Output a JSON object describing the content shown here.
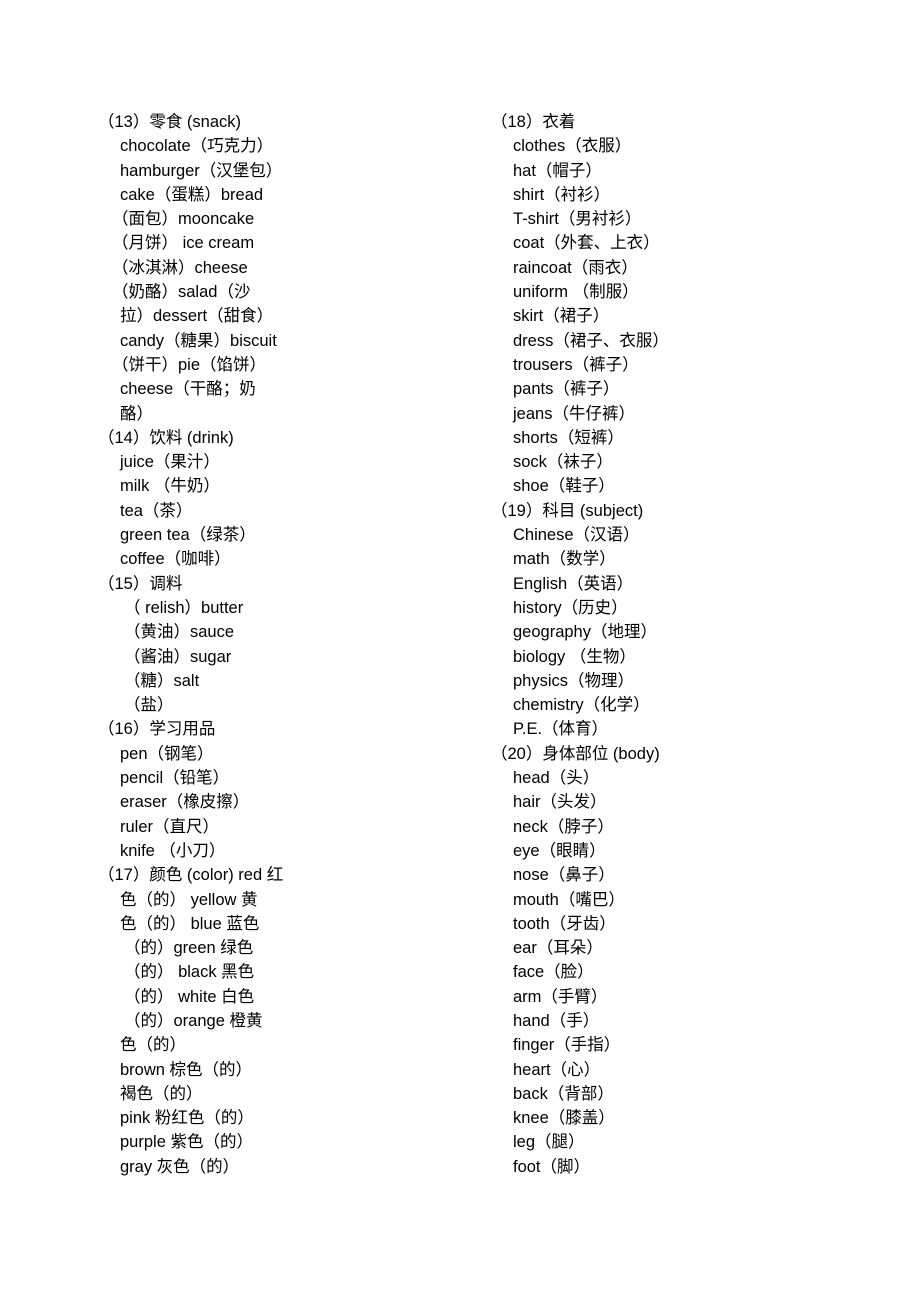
{
  "document": {
    "type": "vocabulary-word-list",
    "language_pair": "English-Chinese",
    "columns": [
      {
        "id": "left-column",
        "sections": [
          {
            "heading": "（13）零食 (snack)",
            "lines": [
              {
                "text": "chocolate（巧克力）",
                "indent": "i1"
              },
              {
                "text": "hamburger（汉堡包）",
                "indent": "i1"
              },
              {
                "text": "cake（蛋糕）bread",
                "indent": "i1"
              },
              {
                "text": "（面包）mooncake",
                "indent": "i2"
              },
              {
                "text": "（月饼） ice cream",
                "indent": "i2"
              },
              {
                "text": "（冰淇淋）cheese",
                "indent": "i2"
              },
              {
                "text": "（奶酪）salad（沙",
                "indent": "i2"
              },
              {
                "text": "拉）dessert（甜食）",
                "indent": "i1"
              },
              {
                "text": "candy（糖果）biscuit",
                "indent": "i1"
              },
              {
                "text": "（饼干）pie（馅饼）",
                "indent": "i2"
              },
              {
                "text": "cheese（干酪；奶",
                "indent": "i1"
              },
              {
                "text": "酪）",
                "indent": "i1"
              }
            ]
          },
          {
            "heading": "（14）饮料 (drink)",
            "lines": [
              {
                "text": "juice（果汁）",
                "indent": "i1"
              },
              {
                "text": "milk （牛奶）",
                "indent": "i1"
              },
              {
                "text": "tea（茶）",
                "indent": "i1"
              },
              {
                "text": "green tea（绿茶）",
                "indent": "i1"
              },
              {
                "text": "coffee（咖啡）",
                "indent": "i1"
              }
            ]
          },
          {
            "heading": "（15）调料",
            "lines": [
              {
                "text": "（ relish）butter",
                "indent": "i3"
              },
              {
                "text": "（黄油）sauce",
                "indent": "i3"
              },
              {
                "text": "（酱油）sugar",
                "indent": "i3"
              },
              {
                "text": "（糖）salt",
                "indent": "i3"
              },
              {
                "text": "（盐）",
                "indent": "i3"
              }
            ]
          },
          {
            "heading": "（16）学习用品",
            "lines": [
              {
                "text": "pen（钢笔）",
                "indent": "i1"
              },
              {
                "text": "pencil（铅笔）",
                "indent": "i1"
              },
              {
                "text": "eraser（橡皮擦）",
                "indent": "i1"
              },
              {
                "text": "ruler（直尺）",
                "indent": "i1"
              },
              {
                "text": "knife （小刀）",
                "indent": "i1"
              }
            ]
          },
          {
            "heading": "（17）颜色 (color) red 红",
            "lines": [
              {
                "text": "色（的） yellow 黄",
                "indent": "i1"
              },
              {
                "text": "色（的） blue 蓝色",
                "indent": "i1"
              },
              {
                "text": "（的）green 绿色",
                "indent": "i3"
              },
              {
                "text": "（的） black 黑色",
                "indent": "i3"
              },
              {
                "text": "（的） white 白色",
                "indent": "i3"
              },
              {
                "text": "（的）orange 橙黄",
                "indent": "i3"
              },
              {
                "text": "色（的）",
                "indent": "i1"
              },
              {
                "text": "brown 棕色（的）",
                "indent": "i1"
              },
              {
                "text": "褐色（的）",
                "indent": "i1"
              },
              {
                "text": "pink 粉红色（的）",
                "indent": "i1"
              },
              {
                "text": "purple 紫色（的）",
                "indent": "i1"
              },
              {
                "text": "gray 灰色（的）",
                "indent": "i1"
              }
            ]
          }
        ]
      },
      {
        "id": "right-column",
        "sections": [
          {
            "heading": "（18）衣着",
            "lines": [
              {
                "text": "clothes（衣服）",
                "indent": "i1"
              },
              {
                "text": "hat（帽子）",
                "indent": "i1"
              },
              {
                "text": "shirt（衬衫）",
                "indent": "i1"
              },
              {
                "text": "T-shirt（男衬衫）",
                "indent": "i1"
              },
              {
                "text": "coat（外套、上衣）",
                "indent": "i1"
              },
              {
                "text": "raincoat（雨衣）",
                "indent": "i1"
              },
              {
                "text": "uniform （制服）",
                "indent": "i1"
              },
              {
                "text": "skirt（裙子）",
                "indent": "i1"
              },
              {
                "text": "dress（裙子、衣服）",
                "indent": "i1"
              },
              {
                "text": "trousers（裤子）",
                "indent": "i1"
              },
              {
                "text": "pants（裤子）",
                "indent": "i1"
              },
              {
                "text": "jeans（牛仔裤）",
                "indent": "i1"
              },
              {
                "text": "shorts（短裤）",
                "indent": "i1"
              },
              {
                "text": "sock（袜子）",
                "indent": "i1"
              },
              {
                "text": "shoe（鞋子）",
                "indent": "i1"
              }
            ]
          },
          {
            "heading": "（19）科目 (subject)",
            "lines": [
              {
                "text": "Chinese（汉语）",
                "indent": "i1"
              },
              {
                "text": "math（数学）",
                "indent": "i1"
              },
              {
                "text": "English（英语）",
                "indent": "i1"
              },
              {
                "text": "history（历史）",
                "indent": "i1"
              },
              {
                "text": "geography（地理）",
                "indent": "i1"
              },
              {
                "text": "biology （生物）",
                "indent": "i1"
              },
              {
                "text": "physics（物理）",
                "indent": "i1"
              },
              {
                "text": "chemistry（化学）",
                "indent": "i1"
              },
              {
                "text": "P.E.（体育）",
                "indent": "i1"
              }
            ]
          },
          {
            "heading": "（20）身体部位 (body)",
            "lines": [
              {
                "text": "head（头）",
                "indent": "i1"
              },
              {
                "text": "hair（头发）",
                "indent": "i1"
              },
              {
                "text": "neck（脖子）",
                "indent": "i1"
              },
              {
                "text": "eye（眼睛）",
                "indent": "i1"
              },
              {
                "text": "nose（鼻子）",
                "indent": "i1"
              },
              {
                "text": "mouth（嘴巴）",
                "indent": "i1"
              },
              {
                "text": "tooth（牙齿）",
                "indent": "i1"
              },
              {
                "text": "ear（耳朵）",
                "indent": "i1"
              },
              {
                "text": "face（脸）",
                "indent": "i1"
              },
              {
                "text": "arm（手臂）",
                "indent": "i1"
              },
              {
                "text": "hand（手）",
                "indent": "i1"
              },
              {
                "text": "finger（手指）",
                "indent": "i1"
              },
              {
                "text": "heart（心）",
                "indent": "i1"
              },
              {
                "text": "back（背部）",
                "indent": "i1"
              },
              {
                "text": "knee（膝盖）",
                "indent": "i1"
              },
              {
                "text": "leg（腿）",
                "indent": "i1"
              },
              {
                "text": "foot（脚）",
                "indent": "i1"
              }
            ]
          }
        ]
      }
    ]
  }
}
